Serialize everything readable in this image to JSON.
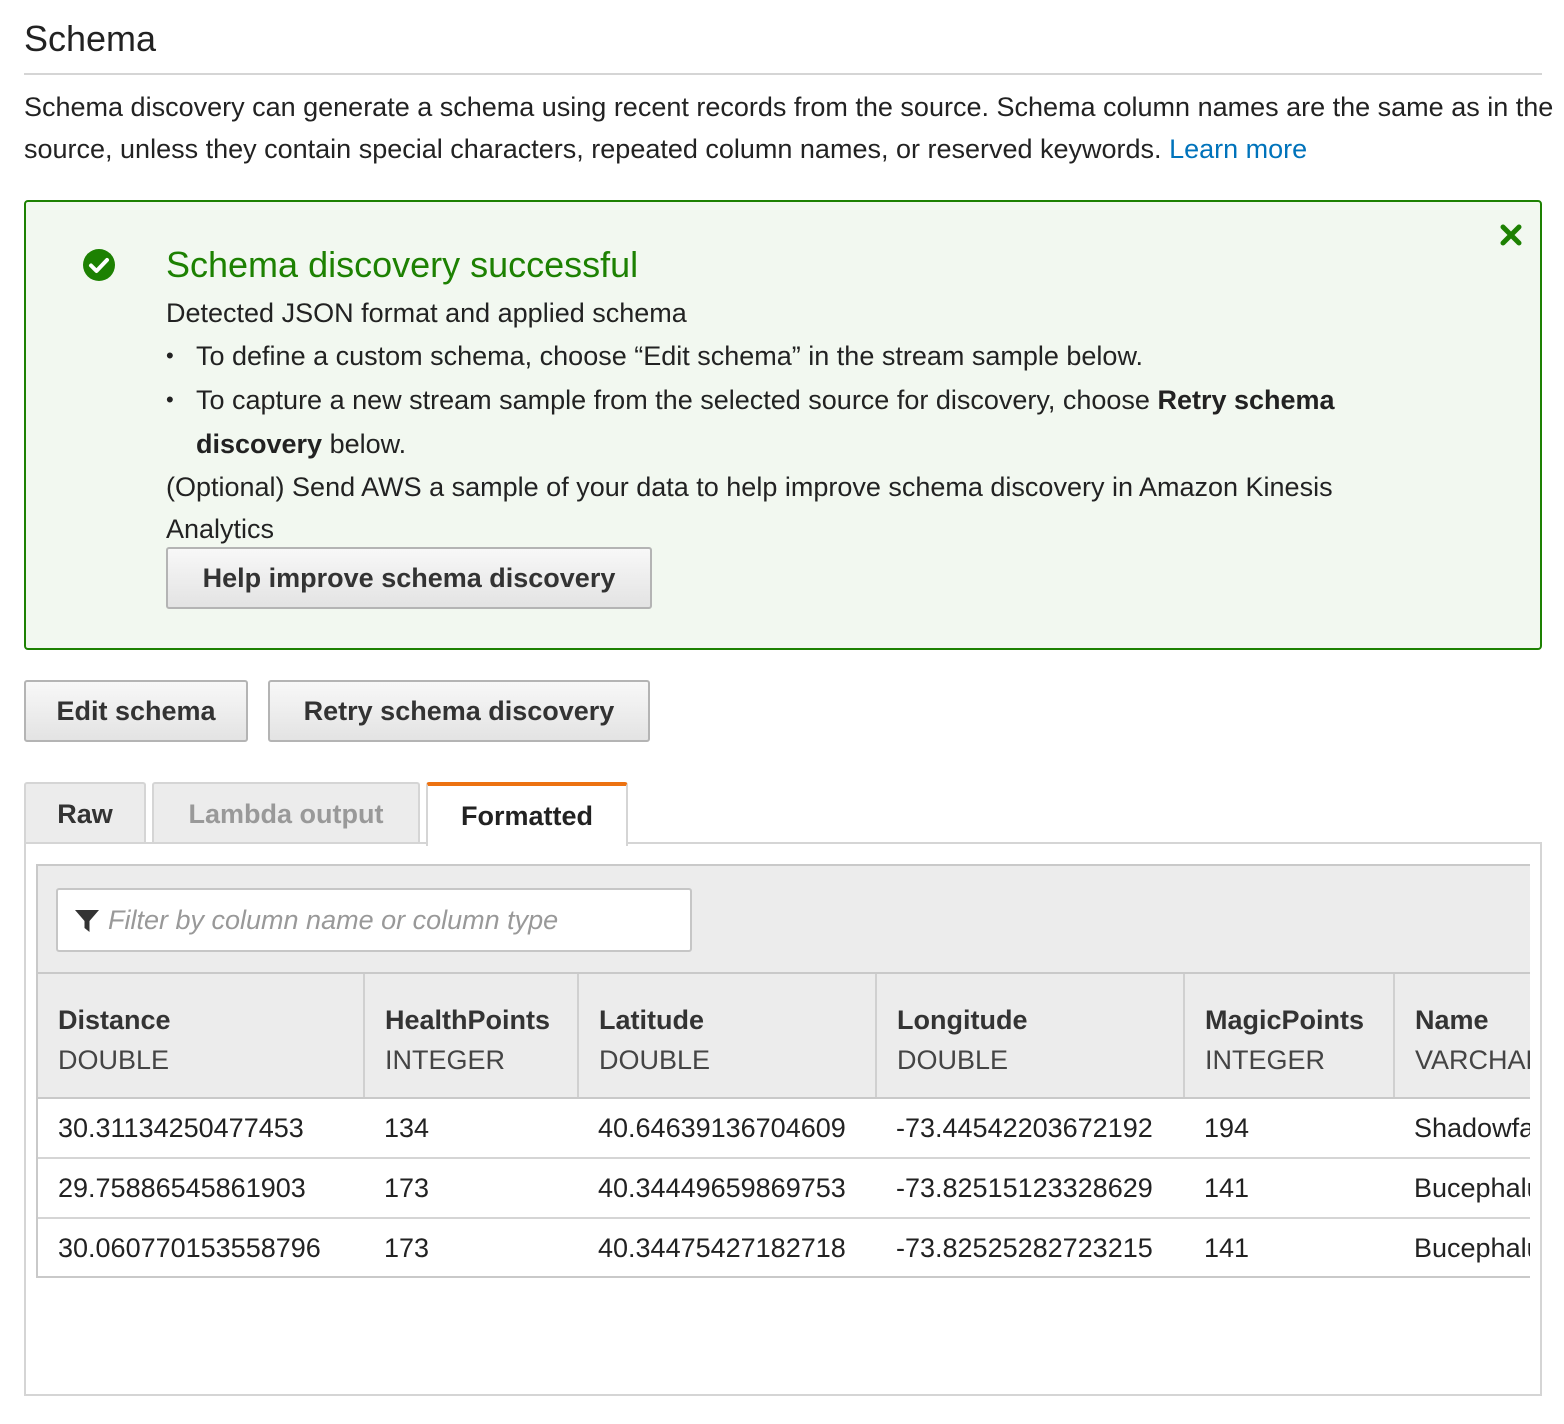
{
  "section": {
    "title": "Schema",
    "description": "Schema discovery can generate a schema using recent records from the source. Schema column names are the same as in the source, unless they contain special characters, repeated column names, or reserved keywords.",
    "learn_more": "Learn more"
  },
  "alert": {
    "title": "Schema discovery successful",
    "detected": "Detected JSON format and applied schema",
    "bullet1": "To define a custom schema, choose “Edit schema” in the stream sample below.",
    "bullet2_prefix": "To capture a new stream sample from the selected source for discovery, choose",
    "bullet2_bold": "Retry schema discovery",
    "bullet2_suffix": "below.",
    "optional": "(Optional) Send AWS a sample of your data to help improve schema discovery in Amazon Kinesis Analytics",
    "help_button": "Help improve schema discovery",
    "status_color": "#1d8102"
  },
  "actions": {
    "edit_schema": "Edit schema",
    "retry_schema": "Retry schema discovery"
  },
  "tabs": [
    {
      "label": "Raw",
      "state": "enabled"
    },
    {
      "label": "Lambda output",
      "state": "disabled"
    },
    {
      "label": "Formatted",
      "state": "active"
    }
  ],
  "filter": {
    "placeholder": "Filter by column name or column type",
    "icon": "filter-icon"
  },
  "table": {
    "columns": [
      {
        "name": "Distance",
        "type": "DOUBLE"
      },
      {
        "name": "HealthPoints",
        "type": "INTEGER"
      },
      {
        "name": "Latitude",
        "type": "DOUBLE"
      },
      {
        "name": "Longitude",
        "type": "DOUBLE"
      },
      {
        "name": "MagicPoints",
        "type": "INTEGER"
      },
      {
        "name": "Name",
        "type": "VARCHAR"
      }
    ],
    "rows": [
      [
        "30.31134250477453",
        "134",
        "40.64639136704609",
        "-73.44542203672192",
        "194",
        "Shadowfax"
      ],
      [
        "29.75886545861903",
        "173",
        "40.34449659869753",
        "-73.82515123328629",
        "141",
        "Bucephalus"
      ],
      [
        "30.060770153558796",
        "173",
        "40.34475427182718",
        "-73.82525282723215",
        "141",
        "Bucephalus"
      ]
    ]
  }
}
